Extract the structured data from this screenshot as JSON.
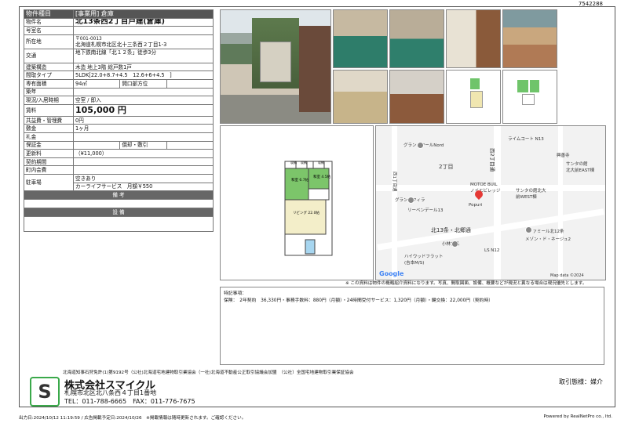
{
  "doc_id": "7542288",
  "spec": {
    "type_label": "物件種目",
    "type_value": "[事業用] 倉庫",
    "name_label": "物件名",
    "name_value": "北13条西2丁目戸建(倉庫)",
    "room_label": "号室名",
    "room_value": "",
    "location_label": "所在地",
    "zip": "〒001-0013",
    "address": "北海道札幌市北区北十三条西２丁目1-3",
    "transit_label": "交通",
    "transit_value": "地下鉄南北線「北１２条」徒歩3分",
    "structure_label": "建築構造",
    "structure_value": "木造 地上3階 総戸数1戸",
    "layout_label": "間取タイプ",
    "layout_value": "5LDK[22.0+8.7+4.5　12.6+6+4.5　]",
    "area_label": "専有面積",
    "area_value": "94㎡",
    "balcony_label": "開口部方位",
    "balcony_value": "",
    "built_label": "築年",
    "built_value": "",
    "status_label": "現況/入居時期",
    "status_value": "空室 / 即入",
    "rent_label": "賃料",
    "rent_value": "105,000 円",
    "fee_label": "共益費・管理費",
    "fee_value": "0円",
    "deposit_label": "敷金",
    "deposit_value": "1ヶ月",
    "key_label": "礼金",
    "key_value": "",
    "guarantee_label": "保証金",
    "guarantee_value": "",
    "guarantee_sub_label": "償却・敷引",
    "guarantee_sub_value": "",
    "renewal_label": "更新料",
    "renewal_value": "（¥11,000）",
    "contract_label": "契約期間",
    "contract_value": "",
    "town_label": "町内会費",
    "town_value": "",
    "parking_label": "駐車場",
    "parking_value1": "空きあり",
    "parking_value2": "カーライフサービス　月額￥550",
    "remarks_bar": "備 考",
    "facilities_bar": "設 備"
  },
  "floorplan": {
    "labels": [
      "収納",
      "収納",
      "収納",
      "和室\n6.7帖",
      "和室\n4.5帖",
      "リビング\n22.0帖"
    ]
  },
  "map": {
    "labels": [
      "グランノワールNord",
      "ライムコート N13",
      "興善寺",
      "サンタの館\n北大前EAST棟",
      "2丁目",
      "MOTOE BUIL\nノイエビレッジ",
      "サンタの館北大\n前WEST棟",
      "Popuri",
      "グランドフィラ",
      "リーベンデール13",
      "北13条・北郷通",
      "小林食品",
      "LS N12",
      "ハイウッドフラット\n(吉本M/S)",
      "ファミール北12条",
      "メゾン・ド・ネージュ2",
      "西2丁目通",
      "西1丁目通",
      "Google",
      "Map data ©2024"
    ]
  },
  "note": "※ この資料は物件の概略紹介資料になります。写真、間取図面、設備、概要などが現況と異なる場合は現況優先とします。",
  "remarks_title": "特記事項：",
  "remarks_text": "保険：　2年契約　36,330円・事務手数料：880円（月額）・24時間受付サービス：1,320円（月額）・鍵交換：22,000円（契約時）",
  "association": "北海道知事石狩免許(1)第9192号（公社)北海道宅地建物取引業協会（一社)北海道不動産公正取引協議会加盟　（公社）全国宅地建物取引業保証協会",
  "company": {
    "name": "株式会社スマイクル",
    "address": "札幌市北区北八条西４丁目1番地",
    "tel": "TEL：011-788-6665　FAX：011-776-7675",
    "logo_letter": "S"
  },
  "deal_type": "取引態様：媒介",
  "footer_left": "出力日:2024/10/12 11:19:59 / 広告掲載予定日:2024/10/26　※掲載情報は随時更新されます。ご確認ください。",
  "footer_right": "Powered by RealNetPro co., ltd.",
  "colors": {
    "header_gray": "#555555",
    "accent_pin": "#e53935",
    "logo_green": "#3aa94a"
  }
}
